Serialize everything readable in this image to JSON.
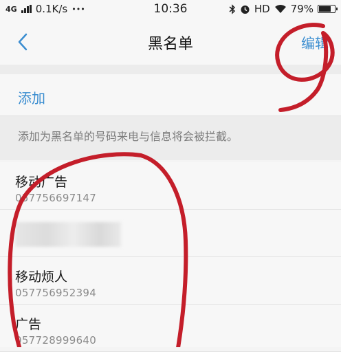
{
  "status_bar": {
    "network_type": "4G",
    "speed": "0.1K/s",
    "dots": "•••",
    "time": "10:36",
    "hd_label": "HD",
    "battery_percent": "79%",
    "battery_level": 0.79,
    "icons": [
      "signal-icon",
      "bluetooth-icon",
      "alarm-icon",
      "wifi-icon",
      "battery-icon"
    ]
  },
  "nav": {
    "title": "黑名单",
    "edit_label": "编辑",
    "back_icon": "chevron-left-icon"
  },
  "add": {
    "label": "添加"
  },
  "hint": "添加为黑名单的号码来电与信息将会被拦截。",
  "blacklist": [
    {
      "name": "移动广告",
      "number": "057756697147",
      "redacted": false
    },
    {
      "name": "",
      "number": "",
      "redacted": true
    },
    {
      "name": "移动烦人",
      "number": "057756952394",
      "redacted": false
    },
    {
      "name": "广告",
      "number": "057728999640",
      "redacted": false
    }
  ],
  "colors": {
    "accent": "#3a8dd0",
    "annotation": "#c41e2a",
    "background": "#f7f7f7"
  }
}
